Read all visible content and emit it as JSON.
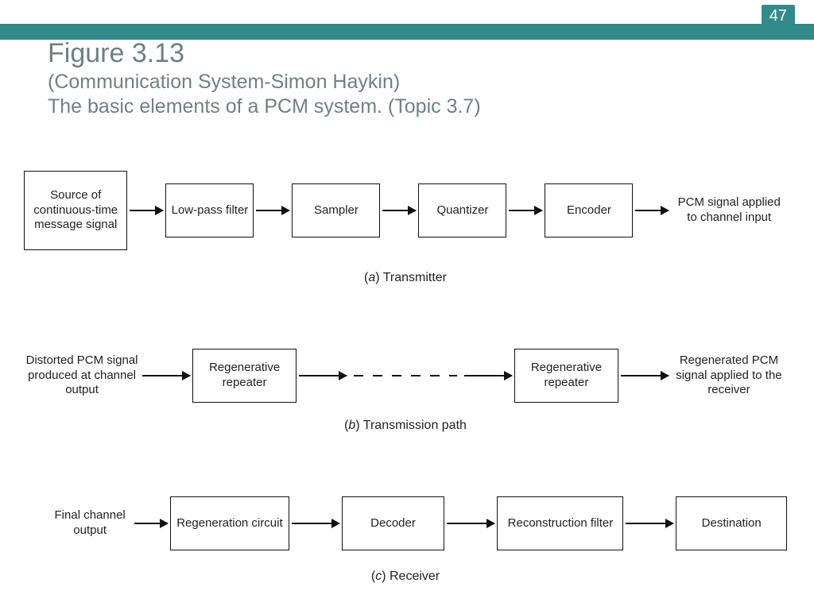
{
  "slide": {
    "page_number": "47",
    "figure_title": "Figure 3.13",
    "subtitle1": "(Communication System-Simon Haykin)",
    "subtitle2": "The basic elements of a PCM system. (Topic 3.7)"
  },
  "rowA": {
    "input_label": "Source of continuous-time message signal",
    "b1": "Low-pass filter",
    "b2": "Sampler",
    "b3": "Quantizer",
    "b4": "Encoder",
    "output_label": "PCM signal applied to channel input",
    "caption": "(a) Transmitter"
  },
  "rowB": {
    "input_label": "Distorted PCM signal produced at channel output",
    "b1": "Regenerative repeater",
    "b2": "Regenerative repeater",
    "output_label": "Regenerated PCM signal applied to the receiver",
    "caption": "(b) Transmission path"
  },
  "rowC": {
    "input_label": "Final channel output",
    "b1": "Regeneration circuit",
    "b2": "Decoder",
    "b3": "Reconstruction filter",
    "b4": "Destination",
    "caption": "(c) Receiver"
  }
}
